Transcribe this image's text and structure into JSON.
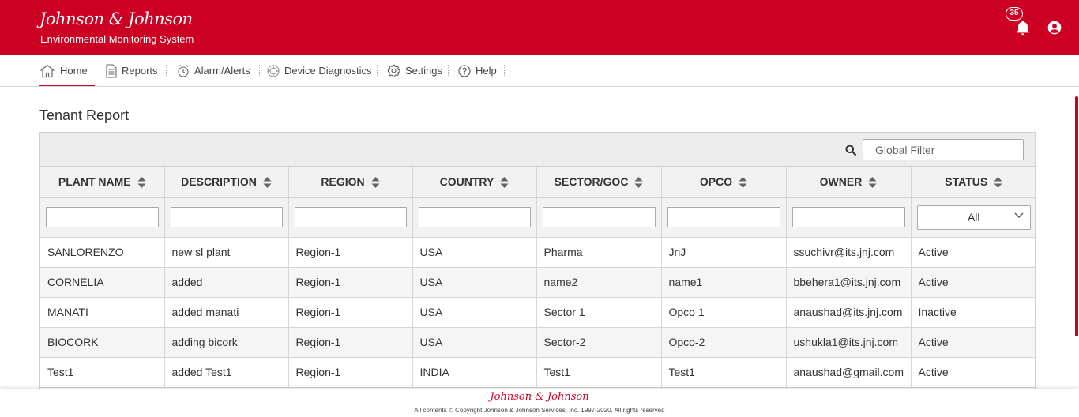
{
  "header": {
    "brand": "Johnson & Johnson",
    "subtitle": "Environmental Monitoring System",
    "notification_count": "35",
    "brand_color": "#cc0022"
  },
  "nav": {
    "items": [
      {
        "label": "Home",
        "icon": "home-icon",
        "active": true
      },
      {
        "label": "Reports",
        "icon": "document-icon"
      },
      {
        "label": "Alarm/Alerts",
        "icon": "alarm-icon"
      },
      {
        "label": "Device Diagnostics",
        "icon": "device-icon"
      },
      {
        "label": "Settings",
        "icon": "gear-icon"
      },
      {
        "label": "Help",
        "icon": "help-icon"
      }
    ]
  },
  "page": {
    "title": "Tenant Report"
  },
  "table": {
    "global_filter_placeholder": "Global Filter",
    "columns": [
      "PLANT NAME",
      "DESCRIPTION",
      "REGION",
      "COUNTRY",
      "SECTOR/GOC",
      "OPCO",
      "OWNER",
      "STATUS"
    ],
    "status_filter": "All",
    "rows": [
      [
        "SANLORENZO",
        "new sl plant",
        "Region-1",
        "USA",
        "Pharma",
        "JnJ",
        "ssuchivr@its.jnj.com",
        "Active"
      ],
      [
        "CORNELIA",
        "added",
        "Region-1",
        "USA",
        "name2",
        "name1",
        "bbehera1@its.jnj.com",
        "Active"
      ],
      [
        "MANATI",
        "added manati",
        "Region-1",
        "USA",
        "Sector 1",
        "Opco 1",
        "anaushad@its.jnj.com",
        "Inactive"
      ],
      [
        "BIOCORK",
        "adding bicork",
        "Region-1",
        "USA",
        "Sector-2",
        "Opco-2",
        "ushukla1@its.jnj.com",
        "Active"
      ],
      [
        "Test1",
        "added Test1",
        "Region-1",
        "INDIA",
        "Test1",
        "Test1",
        "anaushad@gmail.com",
        "Active"
      ]
    ]
  },
  "footer": {
    "brand": "Johnson & Johnson",
    "copyright": "All contents © Copyright Johnson & Johnson Services, Inc. 1997-2020. All rights reserved"
  }
}
